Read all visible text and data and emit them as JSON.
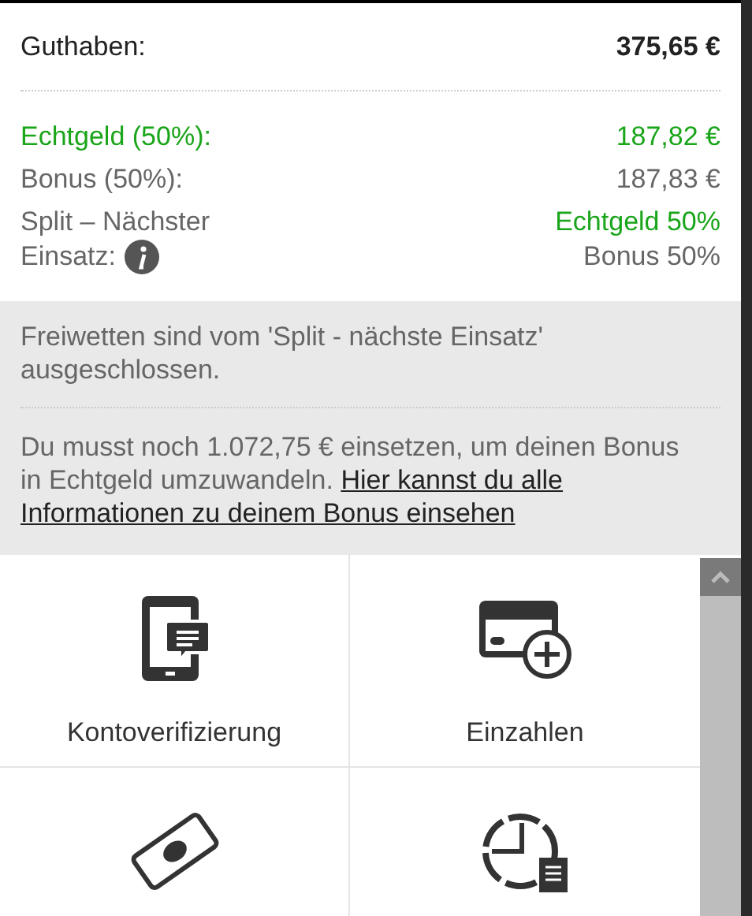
{
  "balance": {
    "label": "Guthaben:",
    "value": "375,65 €"
  },
  "split_rows": [
    {
      "kind": "real",
      "label": "Echtgeld (50%):",
      "value": "187,82 €"
    },
    {
      "kind": "bonus",
      "label": "Bonus (50%):",
      "value": "187,83 €"
    }
  ],
  "next_stake": {
    "label_lines": [
      "Split – Nächster",
      "Einsatz:"
    ],
    "values": [
      {
        "kind": "real",
        "text": "Echtgeld 50%"
      },
      {
        "kind": "bonus",
        "text": "Bonus 50%"
      }
    ]
  },
  "notice": "Freiwetten sind vom 'Split - nächste Einsatz' ausgeschlossen.",
  "wager_info": {
    "text": "Du musst noch 1.072,75 € einsetzen, um deinen Bonus in Echtgeld umzuwandeln.",
    "link_lines": [
      "Hier kannst du alle",
      "Informationen zu deinem Bonus einsehen"
    ]
  },
  "tiles": [
    {
      "kind": "verify",
      "label": "Kontoverifizierung"
    },
    {
      "kind": "deposit",
      "label": "Einzahlen"
    },
    {
      "kind": "withdraw"
    },
    {
      "kind": "history"
    }
  ]
}
